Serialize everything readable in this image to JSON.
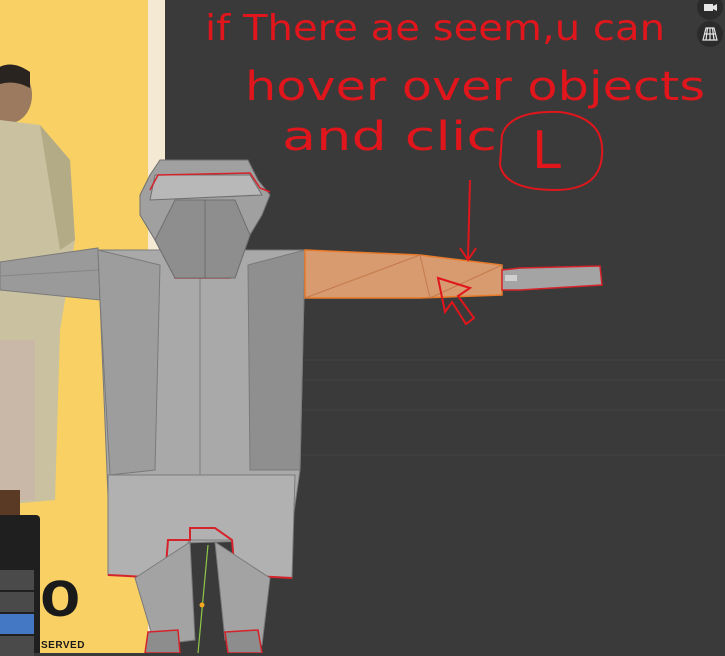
{
  "annotation": {
    "line1": "if There ae seem,u can",
    "line2": "hover over objects",
    "line3": "and clic",
    "key": "L"
  },
  "poster": {
    "footer_text": "SERVED",
    "big_letter": "o"
  },
  "viewport_icons": [
    "camera-icon",
    "grid-icon"
  ],
  "colors": {
    "annotation": "#e0161c",
    "selection": "#e8a87c",
    "seam": "#d4232a",
    "viewport_bg": "#3a3a3a",
    "poster_bg": "#f8d063"
  }
}
